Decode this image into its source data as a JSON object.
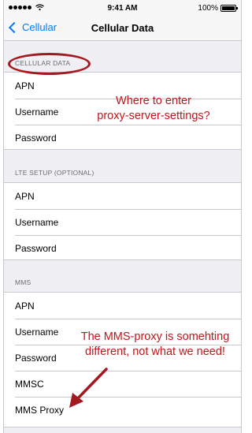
{
  "status_bar": {
    "time": "9:41 AM",
    "battery": "100%",
    "battery_level": 1.0,
    "icons": [
      "signal-dots-icon",
      "wifi-icon",
      "battery-icon"
    ]
  },
  "nav": {
    "back_label": "Cellular",
    "title": "Cellular Data"
  },
  "sections": [
    {
      "header": "CELLULAR DATA",
      "rows": [
        "APN",
        "Username",
        "Password"
      ]
    },
    {
      "header": "LTE SETUP (OPTIONAL)",
      "rows": [
        "APN",
        "Username",
        "Password"
      ]
    },
    {
      "header": "MMS",
      "rows": [
        "APN",
        "Username",
        "Password",
        "MMSC",
        "MMS Proxy"
      ]
    }
  ],
  "annotations": {
    "note1": [
      "Where to enter",
      "proxy-server-settings?"
    ],
    "note2": [
      "The MMS-proxy is somehting",
      "different, not what we need!"
    ],
    "color": "#c0161c"
  },
  "colors": {
    "accent": "#007aff",
    "background": "#efeff4",
    "annotation": "#c0161c"
  }
}
